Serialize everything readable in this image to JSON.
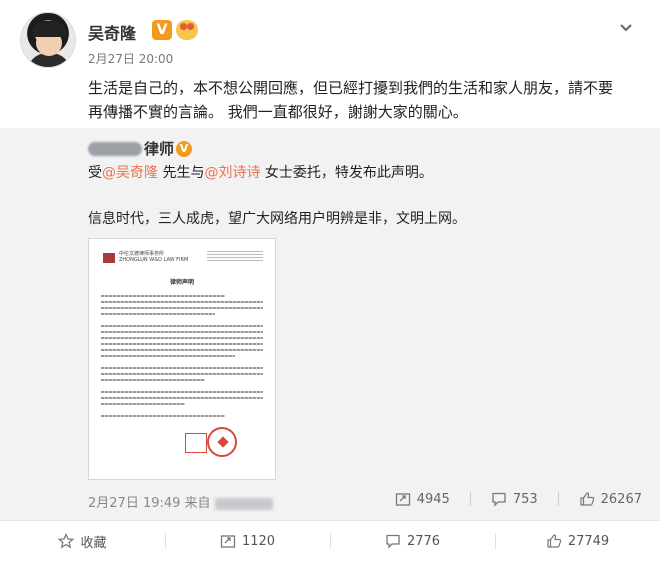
{
  "post": {
    "username": "吴奇隆",
    "verified_badge": "V",
    "time": "2月27日 20:00",
    "text_line1": "生活是自己的，本不想公開回應，但已經打擾到我們的生活和家人朋友，請不要",
    "text_line2": "再傳播不實的言論。 我們一直都很好，謝謝大家的關心。"
  },
  "repost": {
    "author_suffix": "律师",
    "author_badge": "V",
    "line1_prefix": "受",
    "mention1": "@吴奇隆",
    "line1_mid": " 先生与",
    "mention2": "@刘诗诗",
    "line1_suffix": " 女士委托，特发布此声明。",
    "line2": "信息时代，三人成虎，望广大网络用户明辨是非，文明上网。",
    "document": {
      "firm_name_cn": "中伦文德律师事务所",
      "firm_name_en": "ZHONGLUN W&D LAW FIRM",
      "title": "律师声明"
    },
    "footer_time": "2月27日 19:49 来自",
    "stats": {
      "reposts": "4945",
      "comments": "753",
      "likes": "26267"
    }
  },
  "actions": {
    "favorite": "收藏",
    "repost": "1120",
    "comment": "2776",
    "like": "27749"
  },
  "colors": {
    "mention": "#eb7350",
    "verified": "#f29a1e",
    "repost_bg": "#f2f2f2"
  },
  "icons": [
    "more-chevron-icon",
    "repost-icon",
    "comment-icon",
    "like-icon",
    "favorite-star-icon"
  ]
}
